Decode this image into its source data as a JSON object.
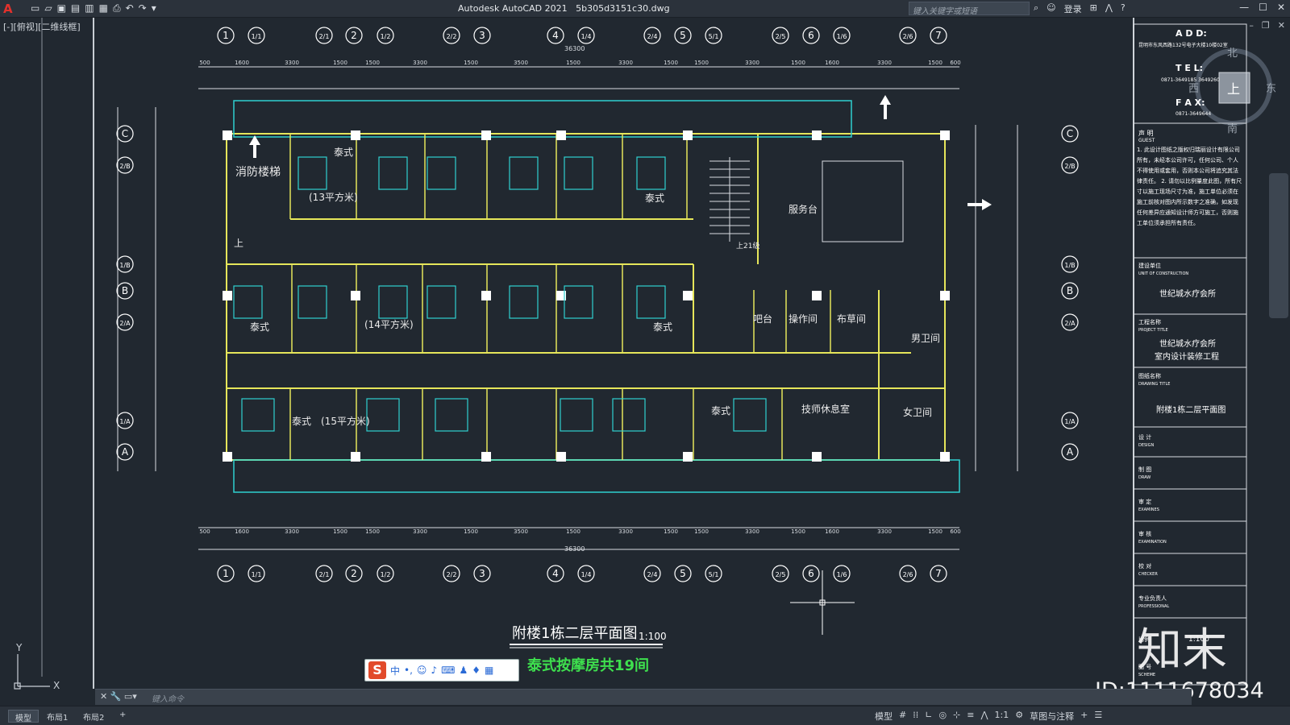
{
  "app": {
    "title": "Autodesk AutoCAD 2021",
    "filename": "5b305d3151c30.dwg",
    "search_placeholder": "键入关键字或短语",
    "login_label": "登录",
    "view_label": "[-][俯视][二维线框]"
  },
  "grid": {
    "col_bubbles": [
      "1",
      "1/1",
      "2/1",
      "2",
      "1/2",
      "2/2",
      "3",
      "4",
      "1/4",
      "2/4",
      "5",
      "5/1",
      "2/5",
      "6",
      "1/6",
      "2/6",
      "7"
    ],
    "row_bubbles": [
      "C",
      "2/B",
      "1/B",
      "B",
      "2/A",
      "1/A",
      "A"
    ],
    "top_dims": [
      "500",
      "1600",
      "3300",
      "1500",
      "1500",
      "3300",
      "1500",
      "3500",
      "1500",
      "3300",
      "1500",
      "1500",
      "3300",
      "1500",
      "1600",
      "3300",
      "1500",
      "600"
    ],
    "overall_dim": "36300"
  },
  "plan": {
    "rooms": [
      {
        "label": "泰式"
      },
      {
        "label": "(13平方米)"
      },
      {
        "label": "泰式"
      },
      {
        "label": "消防楼梯"
      },
      {
        "label": "上"
      },
      {
        "label": "泰式"
      },
      {
        "label": "(14平方米)"
      },
      {
        "label": "泰式"
      },
      {
        "label": "泰式"
      },
      {
        "label": "(15平方米)"
      },
      {
        "label": "泰式"
      },
      {
        "label": "服务台"
      },
      {
        "label": "上21级"
      },
      {
        "label": "吧台"
      },
      {
        "label": "操作间"
      },
      {
        "label": "布草间"
      },
      {
        "label": "男卫间"
      },
      {
        "label": "女卫间"
      },
      {
        "label": "技师休息室"
      }
    ],
    "title": "附楼1栋二层平面图",
    "scale": "1:100",
    "note": "泰式按摩房共19间",
    "compass": {
      "north": "北",
      "south": "南",
      "east": "东",
      "west": "西",
      "up": "上"
    }
  },
  "titleblock": {
    "add_label": "A D D:",
    "add_value": "昆明市东风西路132号电子大楼10楼02室",
    "tel_label": "T E L:",
    "tel_value": "0871-3649185 3649260",
    "fax_label": "F A X:",
    "fax_value": "0871-3649644",
    "notice_title": "声 明",
    "notice_en": "GUEST",
    "notice_text": "1. 此设计图纸之版权归瑞丽设计有限公司所有，未经本公司许可，任何公司、个人不得使用或套用，否则本公司将追究其法律责任。 2. 请勿以比例量度此图，所有尺寸以施工现场尺寸为准，施工单位必须在施工前核对图内所示数字之准确，如发现任何差异应通知设计师方可施工，否则施工单位须承担所有责任。",
    "unit_label": "建设单位",
    "unit_en": "UNIT OF CONSTRUCTION",
    "unit_value": "世纪城水疗会所",
    "project_label": "工程名称",
    "project_en": "PROJECT TITLE",
    "project_value1": "世纪城水疗会所",
    "project_value2": "室内设计装修工程",
    "drawing_label": "图纸名称",
    "drawing_en": "DRAWING TITLE",
    "drawing_value": "附楼1栋二层平面图",
    "rows": [
      {
        "cn": "设 计",
        "en": "DESIGN"
      },
      {
        "cn": "制 图",
        "en": "DRAW"
      },
      {
        "cn": "审 定",
        "en": "EXAMINES"
      },
      {
        "cn": "审 核",
        "en": "EXAMINATION"
      },
      {
        "cn": "校 对",
        "en": "CHECKER"
      },
      {
        "cn": "专业负责人",
        "en": "PROFESSIONAL"
      }
    ],
    "scale_label": "比例",
    "scale_value": "1:100",
    "sheet_label": "图 号",
    "sheet_en": "SCHEME"
  },
  "command": {
    "placeholder": "键入命令"
  },
  "status": {
    "tabs": [
      "模型",
      "布局1",
      "布局2"
    ],
    "model_label": "模型",
    "scale": "1:1",
    "workspace": "草图与注释"
  },
  "watermark": {
    "brand": "知末",
    "id": "ID:1111678034"
  }
}
